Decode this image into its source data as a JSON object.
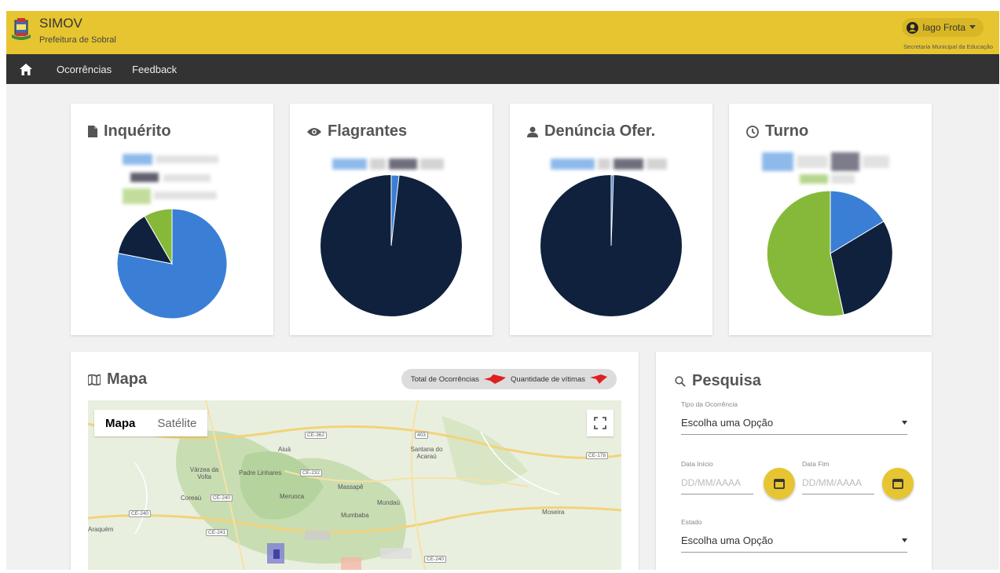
{
  "header": {
    "app_title": "SIMOV",
    "app_subtitle": "Prefeitura de Sobral",
    "user_name": "Iago Frota",
    "user_department": "Secretaria Municipal da Educação",
    "icons": [
      "logo-crest",
      "user-avatar-icon",
      "caret-down-icon"
    ]
  },
  "nav": {
    "home_icon": "home-icon",
    "items": [
      "Ocorrências",
      "Feedback"
    ]
  },
  "cards": [
    {
      "title": "Inquérito",
      "icon": "document-icon"
    },
    {
      "title": "Flagrantes",
      "icon": "eye-icon"
    },
    {
      "title": "Denúncia Ofer.",
      "icon": "person-icon"
    },
    {
      "title": "Turno",
      "icon": "clock-icon"
    }
  ],
  "colors": {
    "brand_yellow": "#e6c530",
    "nav_dark": "#333333",
    "pie_blue": "#3a7fd5",
    "pie_navy": "#0f213d",
    "pie_green": "#86b93a"
  },
  "map": {
    "title": "Mapa",
    "icon": "map-icon",
    "badge_total": "Total de Ocorrências",
    "badge_victims": "Quantidade de vítimas",
    "tab_map": "Mapa",
    "tab_satellite": "Satélite",
    "places": [
      "Aiuá",
      "Santana do Acaraú",
      "Várzea da Volta",
      "Padre Linhares",
      "Massapê",
      "Coreaú",
      "Meruoca",
      "Mundaú",
      "Mumbaba",
      "Araquém",
      "Meruoca",
      "Moseira"
    ],
    "road_tags": [
      "CE-362",
      "403",
      "CE-178",
      "CE-232",
      "CE-240",
      "CE-240",
      "CE-241",
      "CE-240"
    ]
  },
  "search": {
    "title": "Pesquisa",
    "icon": "search-icon",
    "type_label": "Tipo da Ocorrência",
    "type_value": "Escolha uma Opção",
    "start_label": "Data Início",
    "end_label": "Data Fim",
    "date_placeholder": "DD/MM/AAAA",
    "state_label": "Estado",
    "state_value": "Escolha uma Opção"
  }
}
